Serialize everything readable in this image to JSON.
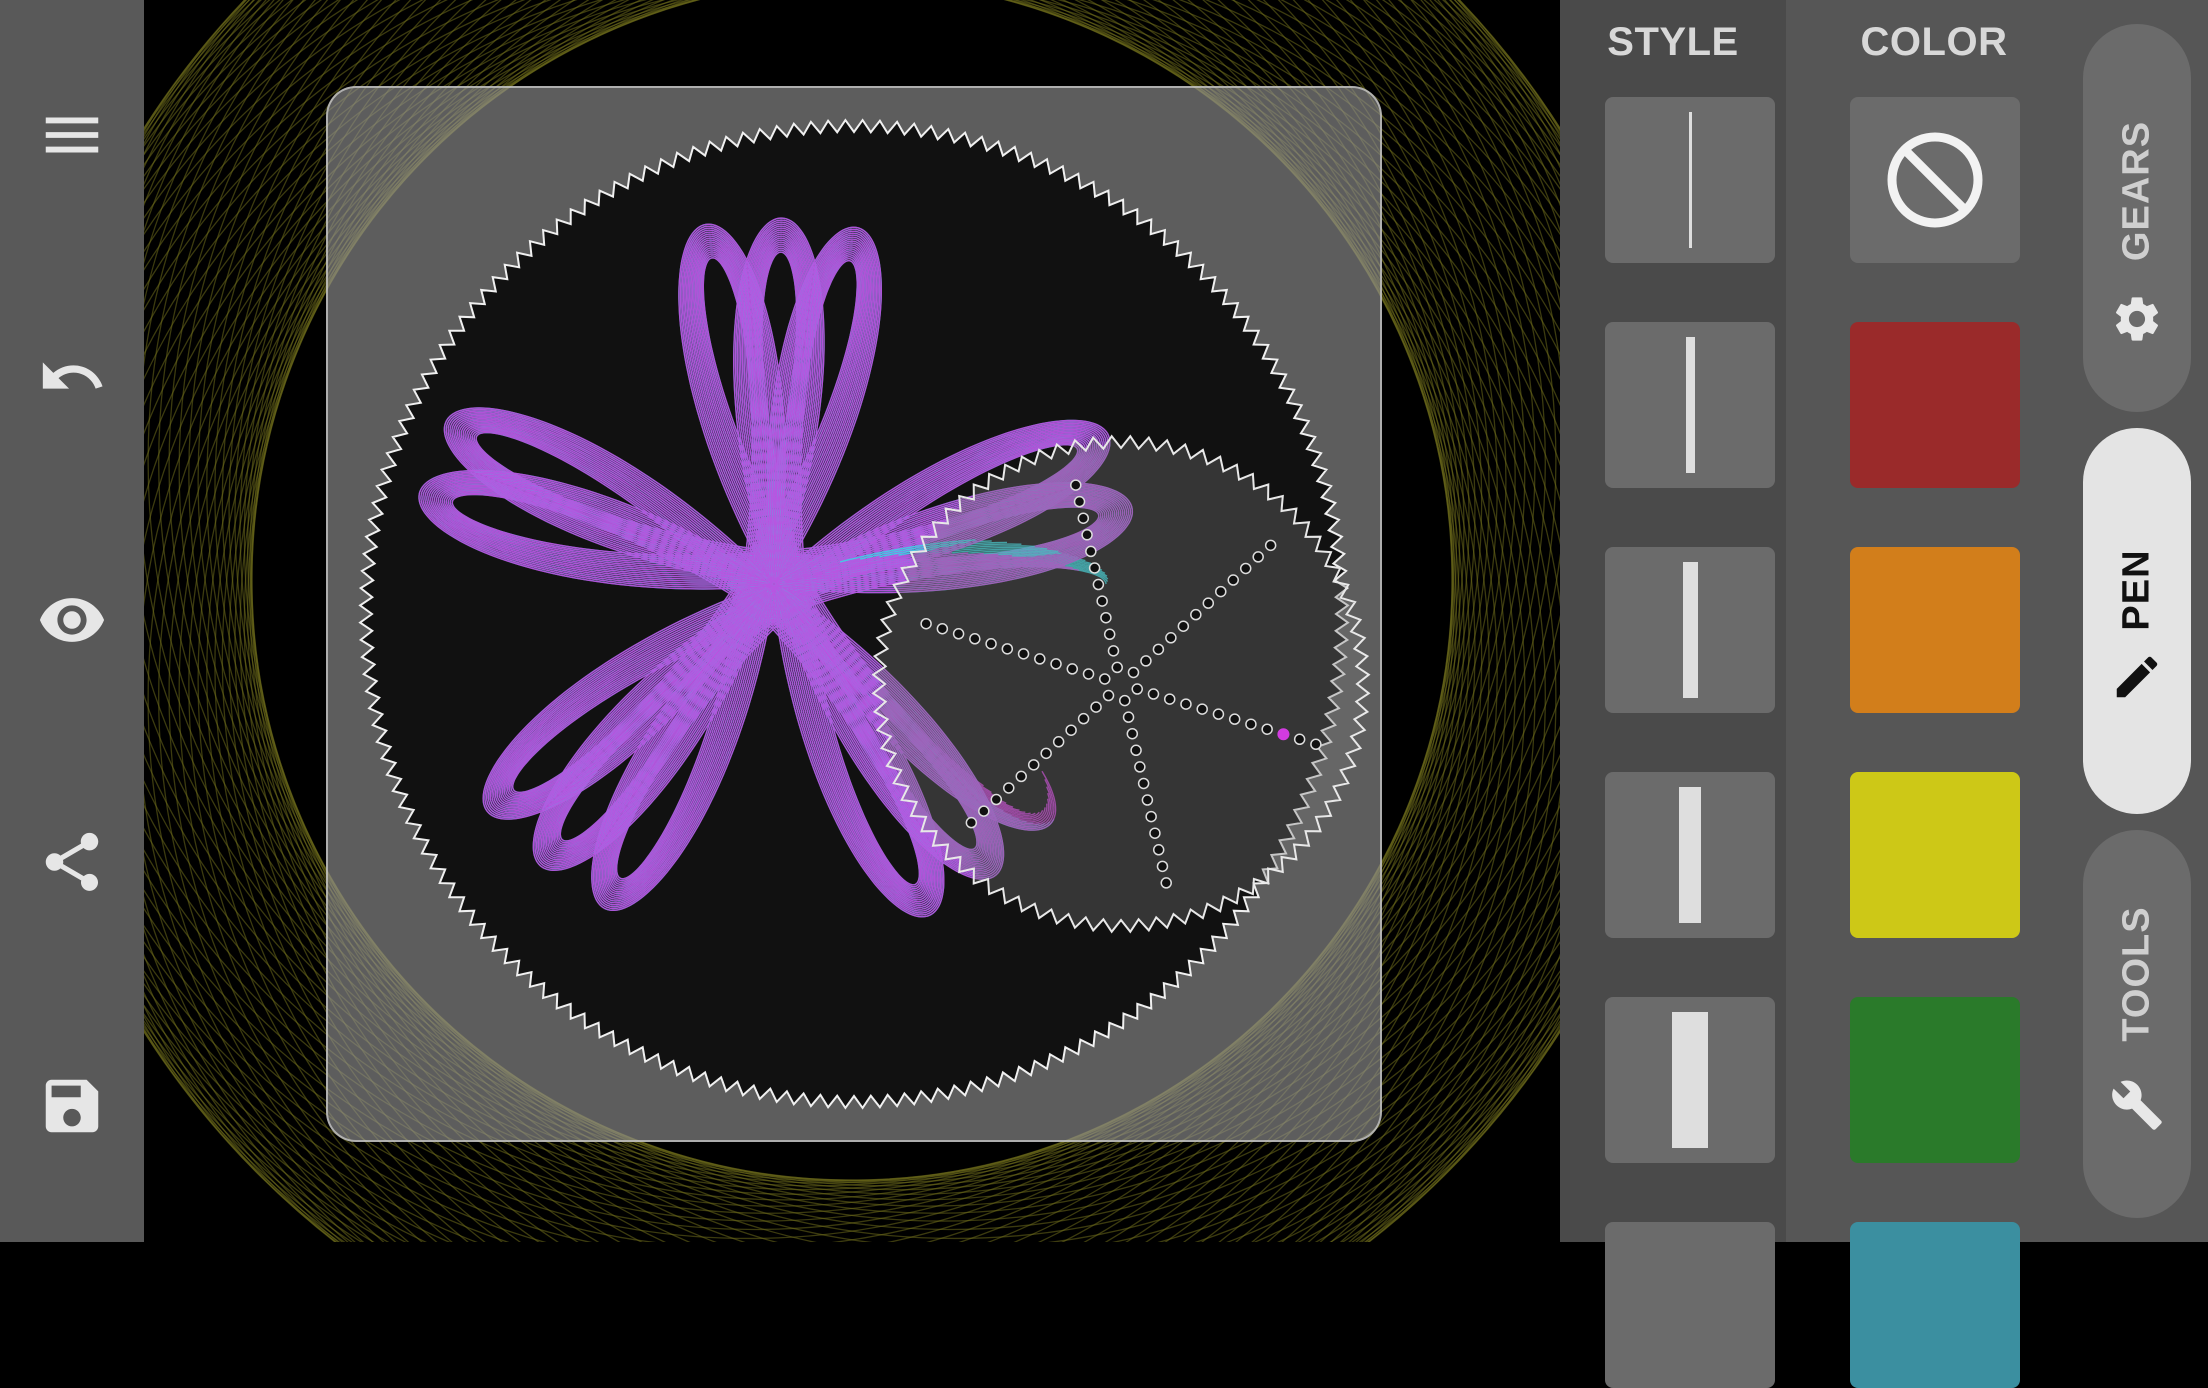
{
  "toolbar": {
    "icons": [
      "menu-icon",
      "undo-icon",
      "eye-icon",
      "share-icon",
      "save-icon"
    ]
  },
  "style_panel": {
    "header": "STYLE",
    "options": [
      "thin",
      "light",
      "medium",
      "bold",
      "extra-bold"
    ]
  },
  "color_panel": {
    "header": "COLOR",
    "swatches": [
      "none",
      "#9a2a2a",
      "#d27e1b",
      "#cdc817",
      "#2a7a2a"
    ],
    "none_icon": "prohibited-icon"
  },
  "tabs": {
    "gears": {
      "label": "GEARS",
      "icon": "gear-icon"
    },
    "pen": {
      "label": "PEN",
      "icon": "pencil-icon",
      "active": true
    },
    "tools": {
      "label": "TOOLS",
      "icon": "wrench-icon"
    }
  },
  "colors": {
    "cyan": "#30e0e6",
    "magenta": "#d23be0",
    "background_swirl": "#6d6b1c"
  }
}
